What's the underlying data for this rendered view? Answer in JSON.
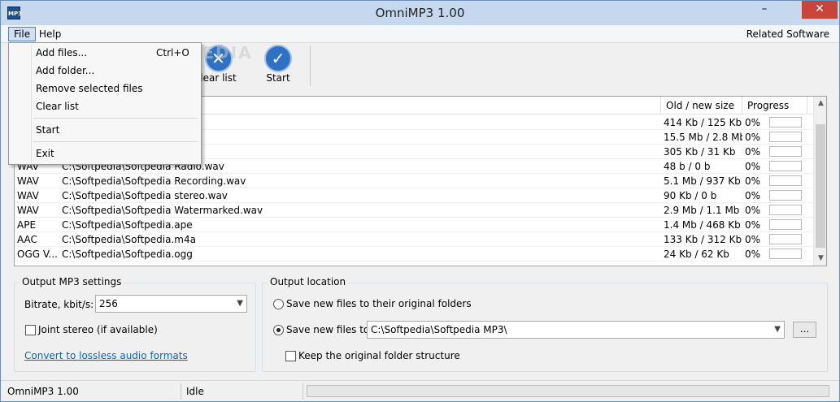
{
  "app": {
    "title": "OmniMP3 1.00",
    "icon_text": "MP3"
  },
  "window_controls": {
    "minimize": "–",
    "close": "✕"
  },
  "menubar": {
    "file": "File",
    "help": "Help",
    "related": "Related Software"
  },
  "file_menu": {
    "items": [
      {
        "label": "Add files...",
        "shortcut": "Ctrl+O"
      },
      {
        "label": "Add folder...",
        "shortcut": ""
      },
      {
        "label": "Remove selected files",
        "shortcut": ""
      },
      {
        "label": "Clear list",
        "shortcut": ""
      },
      {
        "label": "Start",
        "shortcut": ""
      },
      {
        "label": "Exit",
        "shortcut": ""
      }
    ]
  },
  "toolbar": {
    "clear_label": "lear list",
    "clear_icon": "✕",
    "start_label": "Start",
    "start_icon": "✓"
  },
  "watermark": "SOFTPEDIA",
  "list": {
    "headers": {
      "size": "Old / new size",
      "progress": "Progress"
    },
    "rows": [
      {
        "type": "",
        "path": "",
        "size": "414 Kb / 125 Kb",
        "progress": "0%",
        "fill": 0
      },
      {
        "type": "",
        "path": "",
        "size": "15.5 Mb / 2.8 Mb",
        "progress": "0%",
        "fill": 0
      },
      {
        "type": "",
        "path": "",
        "size": "305 Kb / 31 Kb",
        "progress": "0%",
        "fill": 0
      },
      {
        "type": "WAV",
        "path": "C:\\Softpedia\\Softpedia Radio.wav",
        "size": "48 b / 0 b",
        "progress": "0%",
        "fill": 0
      },
      {
        "type": "WAV",
        "path": "C:\\Softpedia\\Softpedia Recording.wav",
        "size": "5.1 Mb / 937 Kb",
        "progress": "0%",
        "fill": 0
      },
      {
        "type": "WAV",
        "path": "C:\\Softpedia\\Softpedia stereo.wav",
        "size": "90 Kb / 0 b",
        "progress": "0%",
        "fill": 0
      },
      {
        "type": "WAV",
        "path": "C:\\Softpedia\\Softpedia Watermarked.wav",
        "size": "2.9 Mb / 1.1 Mb",
        "progress": "0%",
        "fill": 0
      },
      {
        "type": "APE",
        "path": "C:\\Softpedia\\Softpedia.ape",
        "size": "1.4 Mb / 468 Kb",
        "progress": "0%",
        "fill": 0
      },
      {
        "type": "AAC",
        "path": "C:\\Softpedia\\Softpedia.m4a",
        "size": "133 Kb / 312 Kb",
        "progress": "0%",
        "fill": 0
      },
      {
        "type": "OGG V...",
        "path": "C:\\Softpedia\\Softpedia.ogg",
        "size": "24 Kb / 62 Kb",
        "progress": "0%",
        "fill": 0
      }
    ]
  },
  "output_settings": {
    "title": "Output MP3 settings",
    "bitrate_label": "Bitrate, kbit/s:",
    "bitrate_value": "256",
    "joint_stereo_label": "Joint stereo (if available)",
    "joint_stereo_checked": false,
    "lossless_link": "Convert to lossless audio formats"
  },
  "output_location": {
    "title": "Output location",
    "original_label": "Save new files to their original folders",
    "save_to_label": "Save new files to:",
    "path_value": "C:\\Softpedia\\Softpedia MP3\\",
    "browse_label": "...",
    "keep_structure_label": "Keep the original folder structure",
    "keep_structure_checked": false
  },
  "statusbar": {
    "app": "OmniMP3 1.00",
    "state": "Idle",
    "progress": 0
  }
}
